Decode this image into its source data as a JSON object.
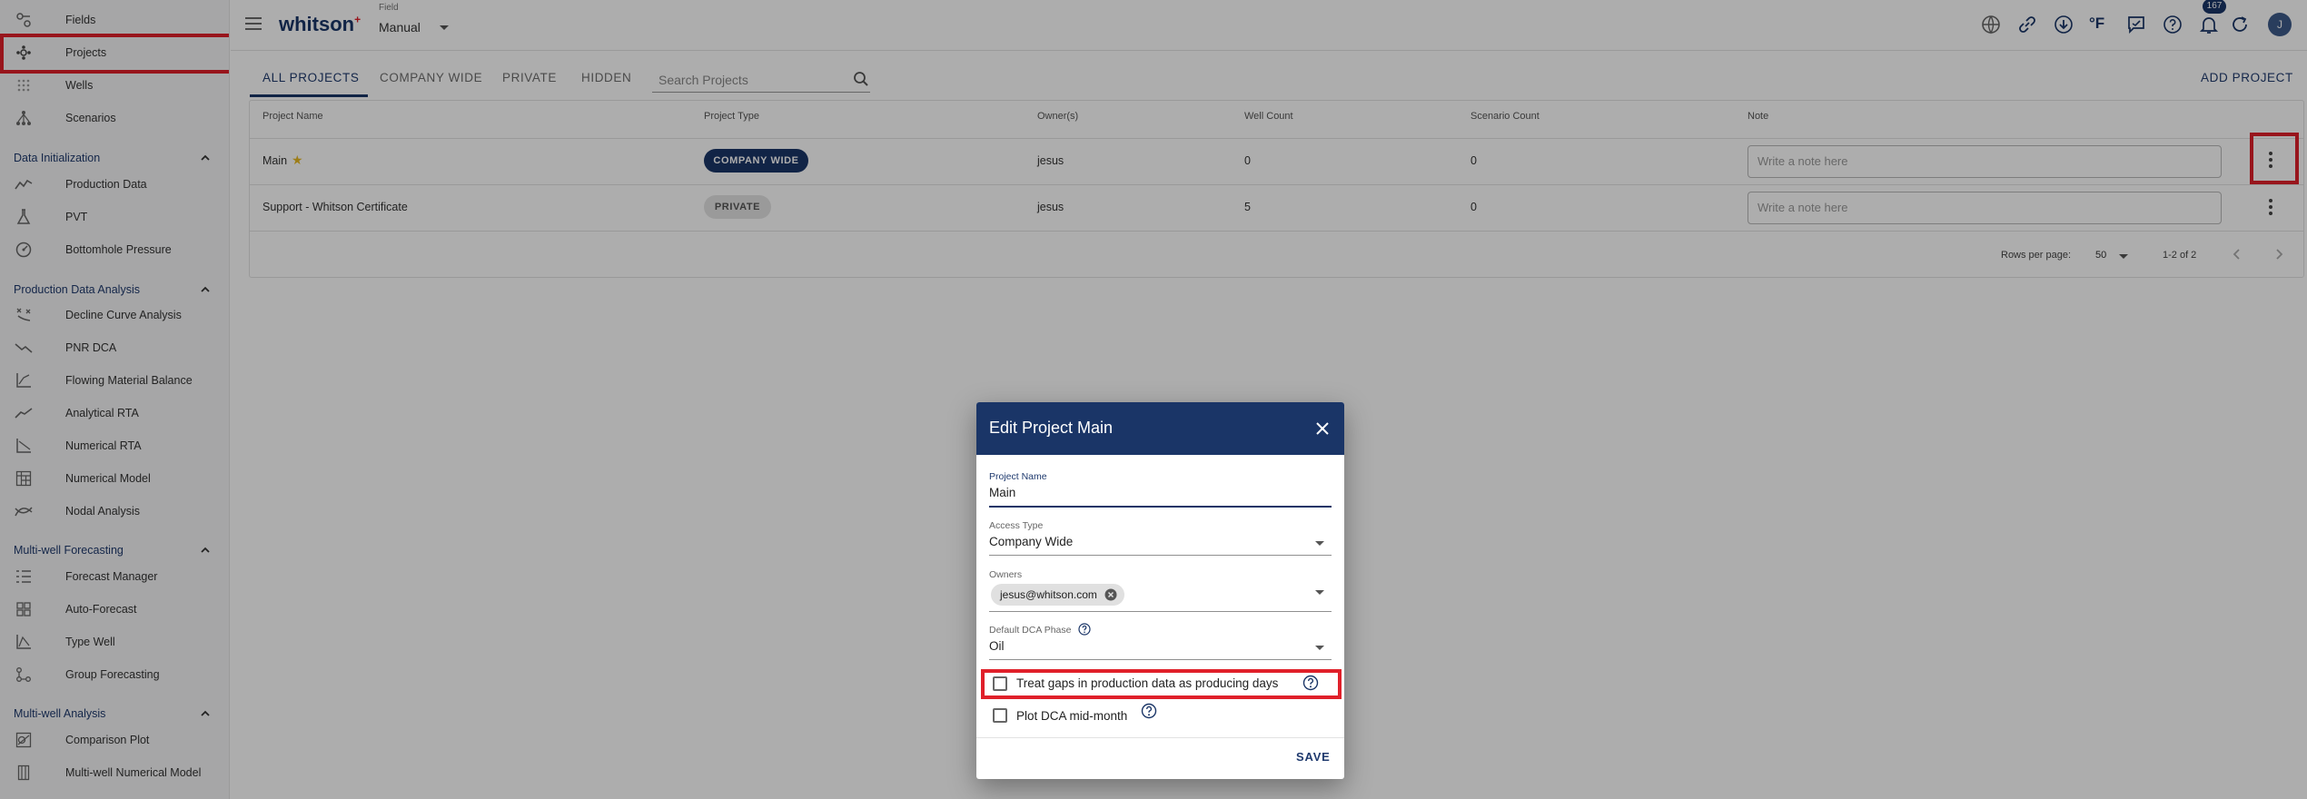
{
  "sidebar": {
    "top_items": [
      {
        "label": "Fields",
        "icon": "fields-icon"
      },
      {
        "label": "Projects",
        "icon": "projects-icon"
      },
      {
        "label": "Wells",
        "icon": "wells-icon"
      },
      {
        "label": "Scenarios",
        "icon": "scenarios-icon"
      }
    ],
    "sections": [
      {
        "title": "Data Initialization",
        "items": [
          {
            "label": "Production Data",
            "icon": "production-data-icon"
          },
          {
            "label": "PVT",
            "icon": "flask-icon"
          },
          {
            "label": "Bottomhole Pressure",
            "icon": "gauge-icon"
          }
        ]
      },
      {
        "title": "Production Data Analysis",
        "items": [
          {
            "label": "Decline Curve Analysis",
            "icon": "decline-curve-icon"
          },
          {
            "label": "PNR DCA",
            "icon": "pnr-dca-icon"
          },
          {
            "label": "Flowing Material Balance",
            "icon": "chart-axes-icon"
          },
          {
            "label": "Analytical RTA",
            "icon": "trend-line-icon"
          },
          {
            "label": "Numerical RTA",
            "icon": "numerical-rta-icon"
          },
          {
            "label": "Numerical Model",
            "icon": "grid-model-icon"
          },
          {
            "label": "Nodal Analysis",
            "icon": "nodal-analysis-icon"
          }
        ]
      },
      {
        "title": "Multi-well Forecasting",
        "items": [
          {
            "label": "Forecast Manager",
            "icon": "list-icon"
          },
          {
            "label": "Auto-Forecast",
            "icon": "grid-icon"
          },
          {
            "label": "Type Well",
            "icon": "type-well-icon"
          },
          {
            "label": "Group Forecasting",
            "icon": "group-forecast-icon"
          }
        ]
      },
      {
        "title": "Multi-well Analysis",
        "items": [
          {
            "label": "Comparison Plot",
            "icon": "comparison-plot-icon"
          },
          {
            "label": "Multi-well Numerical Model",
            "icon": "columns-icon"
          }
        ]
      }
    ]
  },
  "topbar": {
    "brand": "whitson",
    "brand_sup": "+",
    "field_label": "Field",
    "field_value": "Manual",
    "notification_count": "167",
    "avatar_initial": "J",
    "unit_label": "°F"
  },
  "tabs": [
    "ALL PROJECTS",
    "COMPANY WIDE",
    "PRIVATE",
    "HIDDEN"
  ],
  "search_placeholder": "Search Projects",
  "add_project_label": "ADD PROJECT",
  "table": {
    "headers": [
      "Project Name",
      "Project Type",
      "Owner(s)",
      "Well Count",
      "Scenario Count",
      "Note"
    ],
    "rows": [
      {
        "name": "Main",
        "starred": true,
        "type": "COMPANY WIDE",
        "owner": "jesus",
        "wells": "0",
        "scenarios": "0",
        "note_placeholder": "Write a note here"
      },
      {
        "name": "Support - Whitson Certificate",
        "starred": false,
        "type": "PRIVATE",
        "owner": "jesus",
        "wells": "5",
        "scenarios": "0",
        "note_placeholder": "Write a note here"
      }
    ],
    "footer": {
      "rows_per_page_label": "Rows per page:",
      "rows_per_page": "50",
      "range": "1-2 of 2"
    }
  },
  "dialog": {
    "title": "Edit Project Main",
    "project_name_label": "Project Name",
    "project_name_value": "Main",
    "access_type_label": "Access Type",
    "access_type_value": "Company Wide",
    "owners_label": "Owners",
    "owner_chip": "jesus@whitson.com",
    "dca_phase_label": "Default DCA Phase",
    "dca_phase_value": "Oil",
    "checkbox_gaps_label": "Treat gaps in production data as producing days",
    "checkbox_gaps_checked": false,
    "checkbox_midmonth_label": "Plot DCA mid-month",
    "checkbox_midmonth_checked": false,
    "save_label": "SAVE"
  },
  "colors": {
    "brand_navy": "#1a3567",
    "highlight_red": "#e0202a",
    "link_blue": "#1f3a6e"
  }
}
